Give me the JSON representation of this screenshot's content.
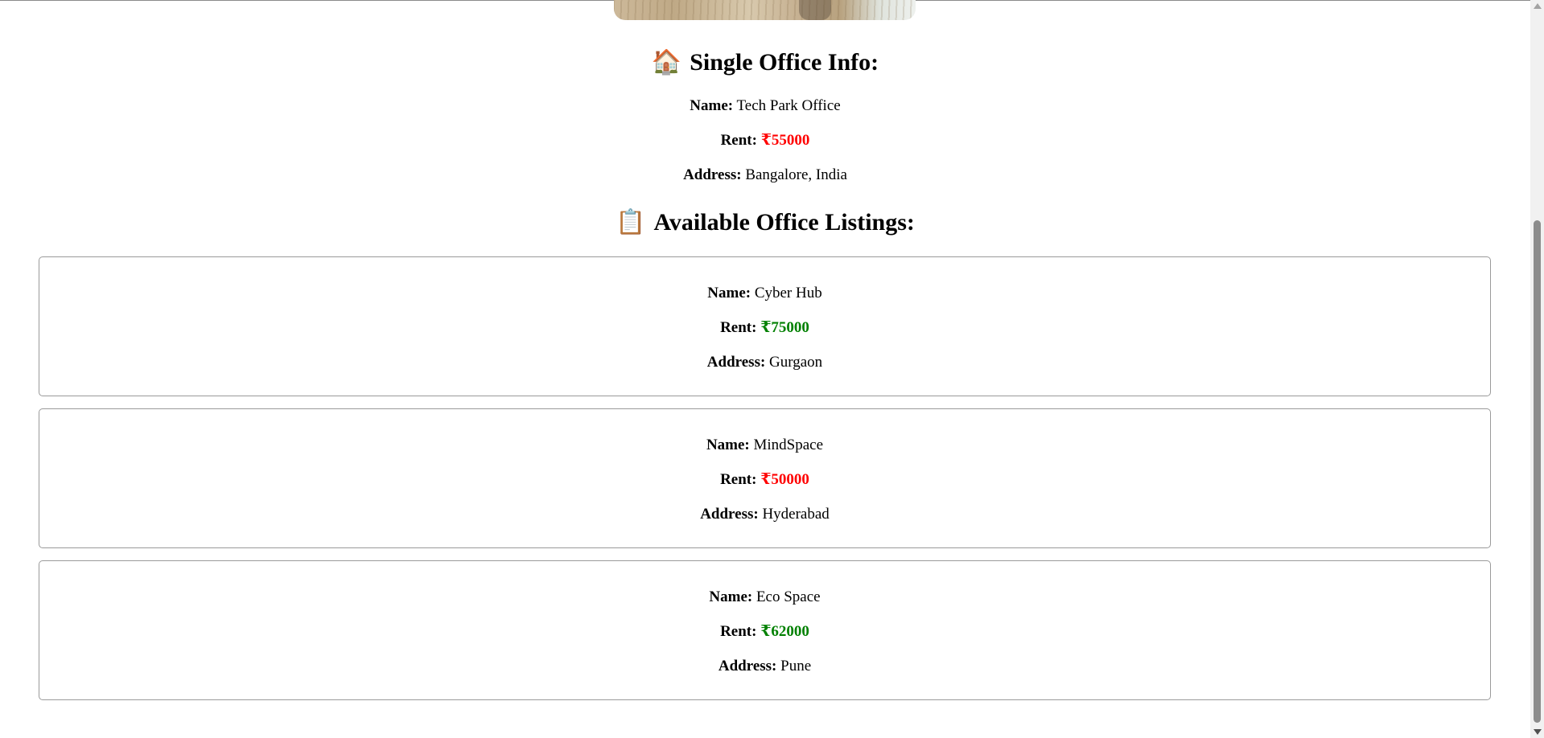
{
  "single_office": {
    "heading_emoji": "🏠",
    "heading": "Single Office Info:",
    "name_label": "Name:",
    "name": "Tech Park Office",
    "rent_label": "Rent:",
    "rent": "₹55000",
    "address_label": "Address:",
    "address": "Bangalore, India"
  },
  "listings_section": {
    "heading_emoji": "📋",
    "heading": "Available Office Listings:"
  },
  "listings": [
    {
      "name_label": "Name:",
      "name": "Cyber Hub",
      "rent_label": "Rent:",
      "rent": "₹75000",
      "rent_color": "#008000",
      "address_label": "Address:",
      "address": "Gurgaon"
    },
    {
      "name_label": "Name:",
      "name": "MindSpace",
      "rent_label": "Rent:",
      "rent": "₹50000",
      "rent_color": "#ff0000",
      "address_label": "Address:",
      "address": "Hyderabad"
    },
    {
      "name_label": "Name:",
      "name": "Eco Space",
      "rent_label": "Rent:",
      "rent": "₹62000",
      "rent_color": "#008000",
      "address_label": "Address:",
      "address": "Pune"
    }
  ],
  "colors": {
    "rent_high": "#ff0000",
    "rent_ok": "#008000",
    "card_border": "#9a9a9a"
  },
  "icons": {
    "house": "house-icon",
    "clipboard": "clipboard-icon"
  }
}
